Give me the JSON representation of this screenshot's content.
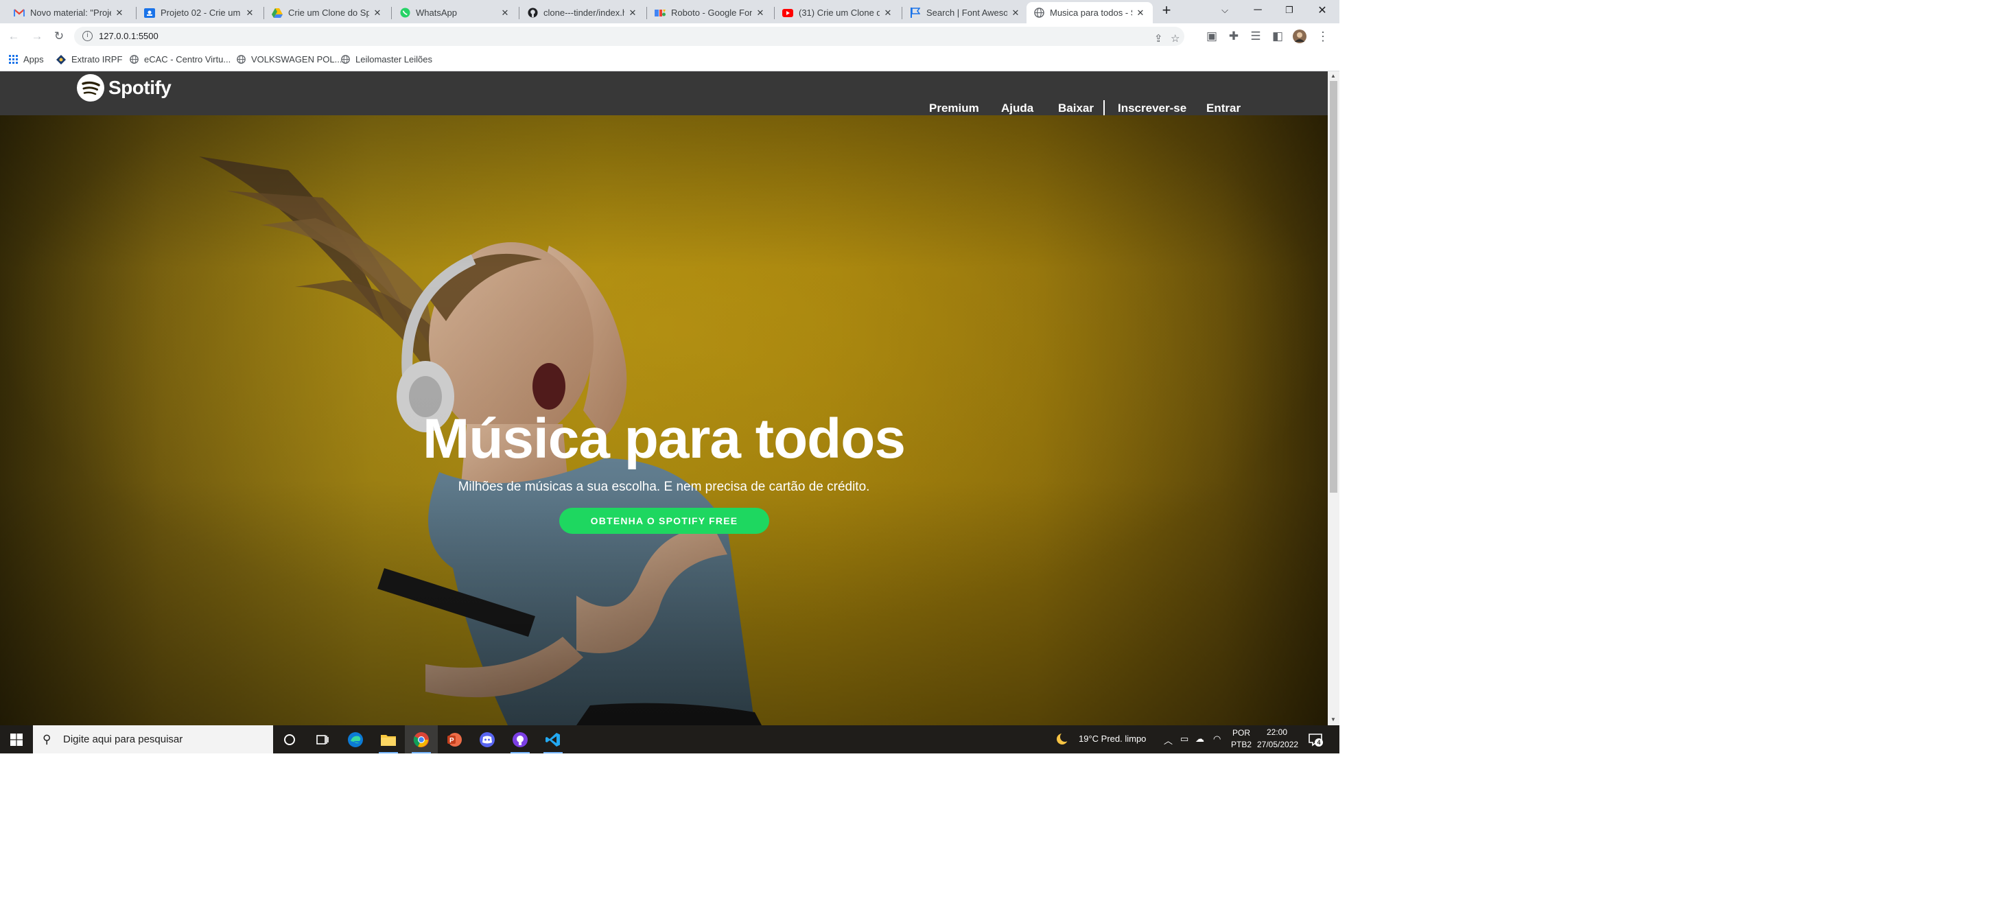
{
  "browser": {
    "tabs": [
      {
        "title": "Novo material: \"Proje",
        "favicon": "gmail-icon",
        "color": "#ea4335"
      },
      {
        "title": "Projeto 02 - Crie um C",
        "favicon": "classroom-icon",
        "color": "#1a73e8"
      },
      {
        "title": "Crie um Clone do Spo",
        "favicon": "drive-icon",
        "color": "#fbbc04"
      },
      {
        "title": "WhatsApp",
        "favicon": "whatsapp-icon",
        "color": "#25d366"
      },
      {
        "title": "clone---tinder/index.h",
        "favicon": "github-icon",
        "color": "#202124"
      },
      {
        "title": "Roboto - Google Fonts",
        "favicon": "google-fonts-icon",
        "color": "#4285f4"
      },
      {
        "title": "(31) Crie um Clone do",
        "favicon": "youtube-icon",
        "color": "#ff0000"
      },
      {
        "title": "Search | Font Awesom",
        "favicon": "font-awesome-icon",
        "color": "#1a73e8"
      },
      {
        "title": "Musica para todos - S",
        "favicon": "globe-icon",
        "color": "#5f6368"
      }
    ],
    "url": "127.0.0.1:5500",
    "bookmarks": [
      {
        "label": "Apps",
        "icon": "apps-grid-icon"
      },
      {
        "label": "Extrato IRPF",
        "icon": "receita-icon"
      },
      {
        "label": "eCAC - Centro Virtu...",
        "icon": "globe-icon"
      },
      {
        "label": "VOLKSWAGEN POL...",
        "icon": "globe-icon"
      },
      {
        "label": "Leilomaster Leilões",
        "icon": "globe-icon"
      }
    ]
  },
  "spotify": {
    "brand": "Spotify",
    "brand_color": "#1ed760",
    "nav": {
      "premium": "Premium",
      "ajuda": "Ajuda",
      "baixar": "Baixar",
      "inscrever": "Inscrever-se",
      "entrar": "Entrar"
    },
    "hero": {
      "title": "Música para todos",
      "subtitle": "Milhões de músicas a sua escolha. E nem precisa de cartão de crédito.",
      "cta": "OBTENHA O SPOTIFY FREE"
    }
  },
  "taskbar": {
    "search_placeholder": "Digite aqui para pesquisar",
    "apps": [
      "cortana-icon",
      "task-view-icon",
      "edge-icon",
      "file-explorer-icon",
      "chrome-icon",
      "powerpoint-icon",
      "discord-icon",
      "github-desktop-icon",
      "vscode-icon"
    ],
    "weather": "19°C  Pred. limpo",
    "lang_top": "POR",
    "lang_bottom": "PTB2",
    "time": "22:00",
    "date": "27/05/2022",
    "notification_count": "4"
  }
}
